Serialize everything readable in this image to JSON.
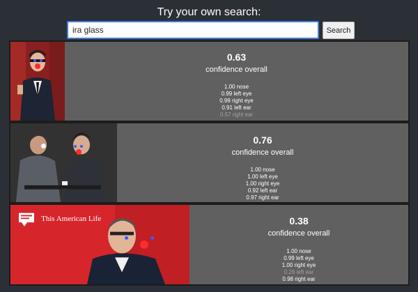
{
  "header": {
    "title": "Try your own search:",
    "search_value": "ira glass",
    "search_button": "Search"
  },
  "results": [
    {
      "score": "0.63",
      "confidence_label": "confidence overall",
      "keypoints": [
        {
          "score": "1.00",
          "part": "nose",
          "low": false
        },
        {
          "score": "0.99",
          "part": "left eye",
          "low": false
        },
        {
          "score": "0.99",
          "part": "right eye",
          "low": false
        },
        {
          "score": "0.91",
          "part": "left ear",
          "low": false
        },
        {
          "score": "0.57",
          "part": "right ear",
          "low": true
        }
      ]
    },
    {
      "score": "0.76",
      "confidence_label": "confidence overall",
      "keypoints": [
        {
          "score": "1.00",
          "part": "nose",
          "low": false
        },
        {
          "score": "1.00",
          "part": "left eye",
          "low": false
        },
        {
          "score": "1.00",
          "part": "right eye",
          "low": false
        },
        {
          "score": "0.92",
          "part": "left ear",
          "low": false
        },
        {
          "score": "0.97",
          "part": "right ear",
          "low": false
        }
      ]
    },
    {
      "score": "0.38",
      "confidence_label": "confidence overall",
      "keypoints": [
        {
          "score": "1.00",
          "part": "nose",
          "low": false
        },
        {
          "score": "0.99",
          "part": "left eye",
          "low": false
        },
        {
          "score": "1.00",
          "part": "right eye",
          "low": false
        },
        {
          "score": "0.26",
          "part": "left ear",
          "low": true
        },
        {
          "score": "0.98",
          "part": "right ear",
          "low": false
        }
      ]
    }
  ],
  "images": {
    "third_logo_text": "This American Life"
  },
  "colors": {
    "page_bg": "#2b2f36",
    "card_bg": "#606060",
    "nose_dot": "#ff2b2b",
    "eye_dot": "#3b5bff",
    "low_confidence_text": "#a3a3a3"
  }
}
